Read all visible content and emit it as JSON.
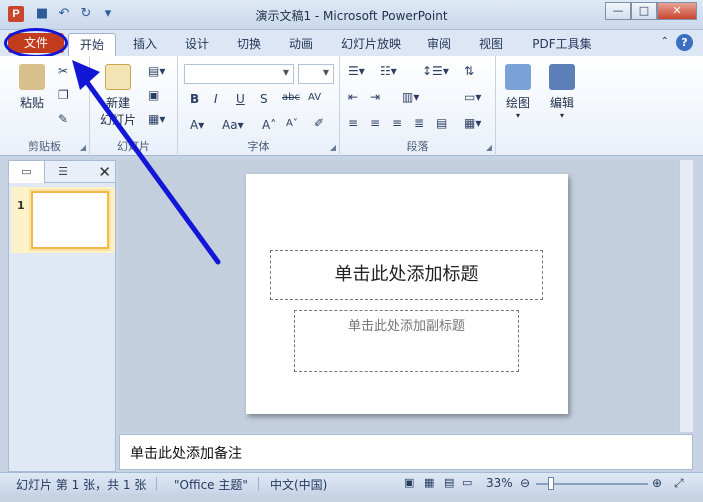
{
  "window": {
    "title": "演示文稿1 - Microsoft PowerPoint",
    "app_icon": "P"
  },
  "tabs": {
    "file": "文件",
    "home": "开始",
    "insert": "插入",
    "design": "设计",
    "transitions": "切换",
    "animations": "动画",
    "slideshow": "幻灯片放映",
    "review": "审阅",
    "view": "视图",
    "pdf": "PDF工具集"
  },
  "ribbon": {
    "clipboard": {
      "paste": "粘贴",
      "label": "剪贴板"
    },
    "slides": {
      "new_slide": "新建",
      "new_slide2": "幻灯片",
      "label": "幻灯片"
    },
    "font": {
      "label": "字体"
    },
    "paragraph": {
      "label": "段落"
    },
    "drawing": {
      "label": "绘图"
    },
    "editing": {
      "label": "编辑"
    }
  },
  "slide_panel": {
    "slide_number": "1"
  },
  "slide": {
    "title_placeholder": "单击此处添加标题",
    "subtitle_placeholder": "单击此处添加副标题"
  },
  "notes": {
    "placeholder": "单击此处添加备注"
  },
  "status": {
    "slide_info": "幻灯片 第 1 张，共 1 张",
    "theme": "\"Office 主题\"",
    "language": "中文(中国)",
    "zoom": "33%"
  },
  "colors": {
    "file_tab": "#c43c1e",
    "annotation": "#1216d6"
  }
}
